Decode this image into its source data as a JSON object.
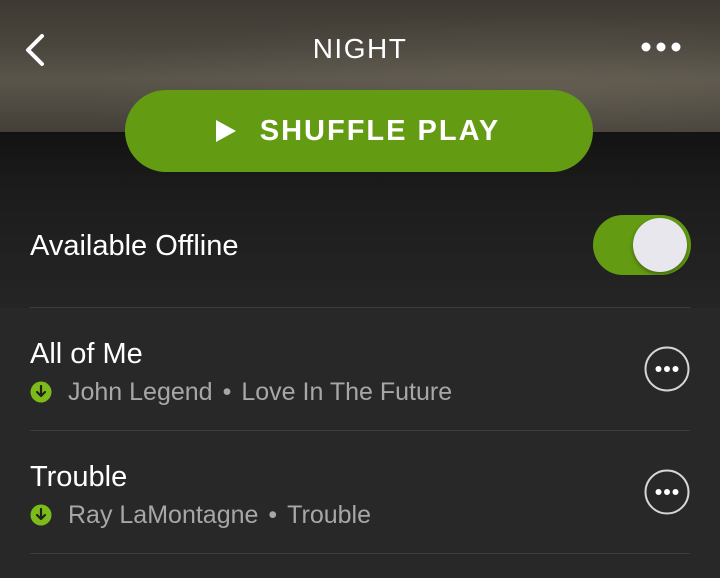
{
  "header": {
    "title": "NIGHT",
    "back_icon": "chevron-left-icon",
    "more_icon": "more-horizontal-icon"
  },
  "shuffle": {
    "label": "SHUFFLE PLAY",
    "icon": "play-icon"
  },
  "offline": {
    "label": "Available Offline",
    "enabled": true
  },
  "tracks": [
    {
      "title": "All of Me",
      "artist": "John Legend",
      "album": "Love In The Future",
      "separator": "•",
      "downloaded": true
    },
    {
      "title": "Trouble",
      "artist": "Ray LaMontagne",
      "album": "Trouble",
      "separator": "•",
      "downloaded": true
    }
  ],
  "colors": {
    "accent_green": "#639b13",
    "background": "#282828",
    "text_primary": "#ffffff",
    "text_secondary": "#a7a7a7",
    "download_green": "#7dbb1a"
  }
}
